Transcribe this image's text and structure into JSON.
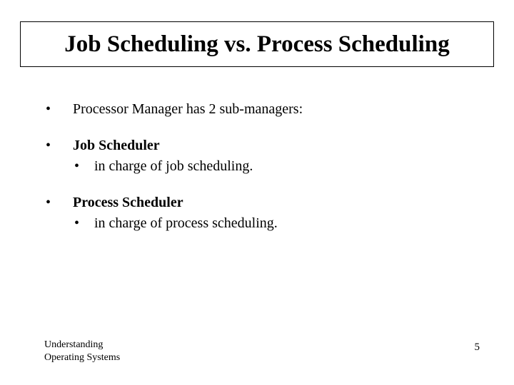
{
  "title": "Job Scheduling vs. Process Scheduling",
  "bullets": {
    "b1_text": "Processor Manager has 2 sub-managers:",
    "b2_header": "Job Scheduler",
    "b2_sub1": "in charge of job scheduling.",
    "b3_header": "Process Scheduler",
    "b3_sub1": "in charge of process scheduling."
  },
  "footer": {
    "line1": "Understanding",
    "line2": "Operating Systems",
    "page_number": "5"
  }
}
